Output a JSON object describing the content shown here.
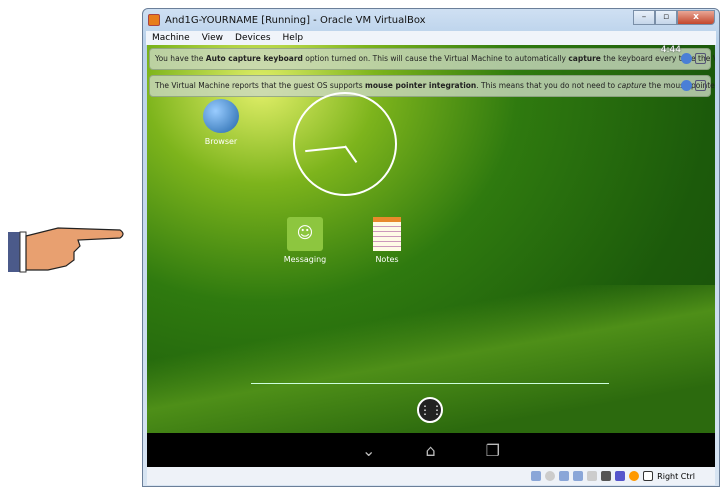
{
  "window": {
    "title": "And1G-YOURNAME [Running] - Oracle VM VirtualBox",
    "minimize": "–",
    "maximize": "▫",
    "close": "x"
  },
  "menu": [
    "Machine",
    "View",
    "Devices",
    "Help"
  ],
  "notices": [
    {
      "pre": "You have the ",
      "b1": "Auto capture keyboard",
      "mid": " option turned on. This will cause the Virtual Machine to automatically ",
      "b2": "capture",
      "post": " the keyboard every time the VM"
    },
    {
      "pre": "The Virtual Machine reports that the guest OS supports ",
      "b1": "mouse pointer integration",
      "mid": ". This means that you do not need to ",
      "b2": "capture",
      "post": " the mouse pointer"
    }
  ],
  "android": {
    "time": "4:44",
    "apps": [
      {
        "label": "Browser"
      },
      {
        "label": "Messaging"
      },
      {
        "label": "Notes"
      }
    ],
    "all_apps": "⋮⋮"
  },
  "statusbar": {
    "host_key": "Right Ctrl"
  },
  "colors": {
    "messaging": "#8dc63f",
    "wallpaper": "#2f7a0f"
  }
}
